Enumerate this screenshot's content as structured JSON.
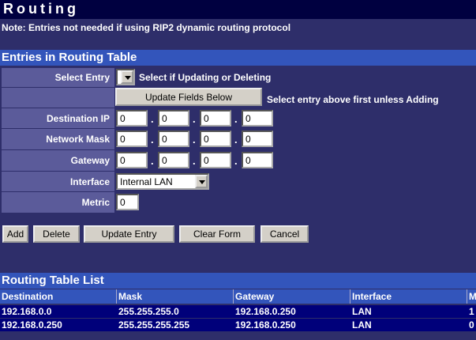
{
  "page": {
    "title": "Routing",
    "note": "Note: Entries not needed if using RIP2 dynamic routing protocol"
  },
  "entries_section": {
    "header": "Entries in Routing Table",
    "select_entry_label": "Select Entry",
    "select_entry_hint": "Select if Updating or Deleting",
    "update_fields_button": "Update Fields Below",
    "update_fields_hint": "Select entry above first unless Adding",
    "destination_ip": {
      "label": "Destination IP",
      "octets": [
        "0",
        "0",
        "0",
        "0"
      ]
    },
    "network_mask": {
      "label": "Network Mask",
      "octets": [
        "0",
        "0",
        "0",
        "0"
      ]
    },
    "gateway": {
      "label": "Gateway",
      "octets": [
        "0",
        "0",
        "0",
        "0"
      ]
    },
    "interface": {
      "label": "Interface",
      "value": "Internal LAN"
    },
    "metric": {
      "label": "Metric",
      "value": "0"
    },
    "dot": "."
  },
  "actions": {
    "add": "Add",
    "delete": "Delete",
    "update_entry": "Update Entry",
    "clear_form": "Clear Form",
    "cancel": "Cancel"
  },
  "routing_list": {
    "header": "Routing Table List",
    "columns": [
      "Destination",
      "Mask",
      "Gateway",
      "Interface",
      "M"
    ],
    "rows": [
      [
        "192.168.0.0",
        "255.255.255.0",
        "192.168.0.250",
        "LAN",
        "1"
      ],
      [
        "192.168.0.250",
        "255.255.255.255",
        "192.168.0.250",
        "LAN",
        "0"
      ]
    ]
  },
  "colors": {
    "background": "#2e2e6a",
    "title_bar": "#000040",
    "section_header": "#3355bb",
    "label_cell": "#5b5b9a",
    "table_row": "#00007a"
  }
}
